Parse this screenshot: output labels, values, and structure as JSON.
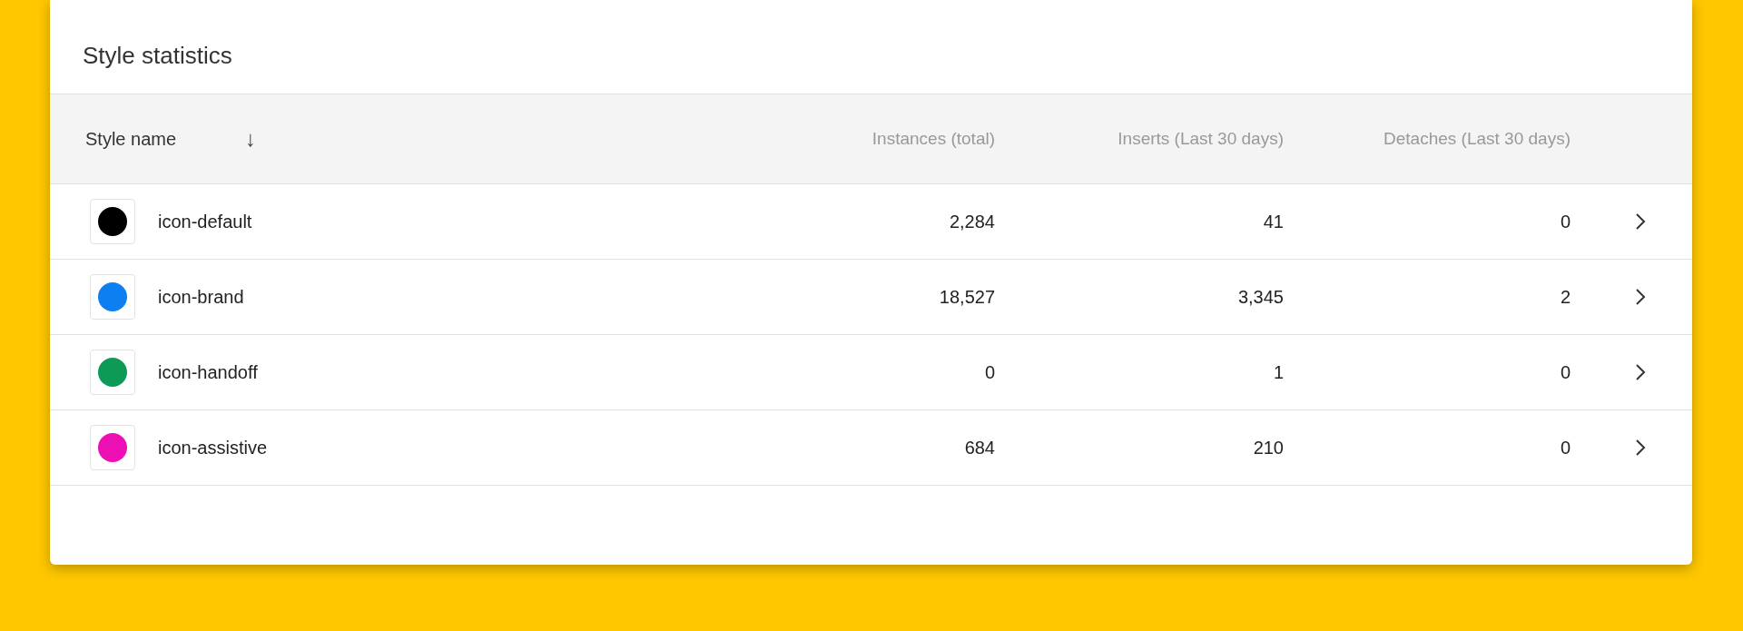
{
  "panel": {
    "title": "Style statistics"
  },
  "table": {
    "columns": [
      {
        "label": "Style name",
        "sort_indicator": "↓"
      },
      {
        "label": "Instances (total)"
      },
      {
        "label": "Inserts (Last 30 days)"
      },
      {
        "label": "Detaches (Last 30 days)"
      }
    ],
    "rows": [
      {
        "name": "icon-default",
        "color": "#000000",
        "instances": "2,284",
        "inserts": "41",
        "detaches": "0"
      },
      {
        "name": "icon-brand",
        "color": "#0d7ff0",
        "instances": "18,527",
        "inserts": "3,345",
        "detaches": "2"
      },
      {
        "name": "icon-handoff",
        "color": "#0d9a57",
        "instances": "0",
        "inserts": "1",
        "detaches": "0"
      },
      {
        "name": "icon-assistive",
        "color": "#ec0fb4",
        "instances": "684",
        "inserts": "210",
        "detaches": "0"
      }
    ]
  }
}
